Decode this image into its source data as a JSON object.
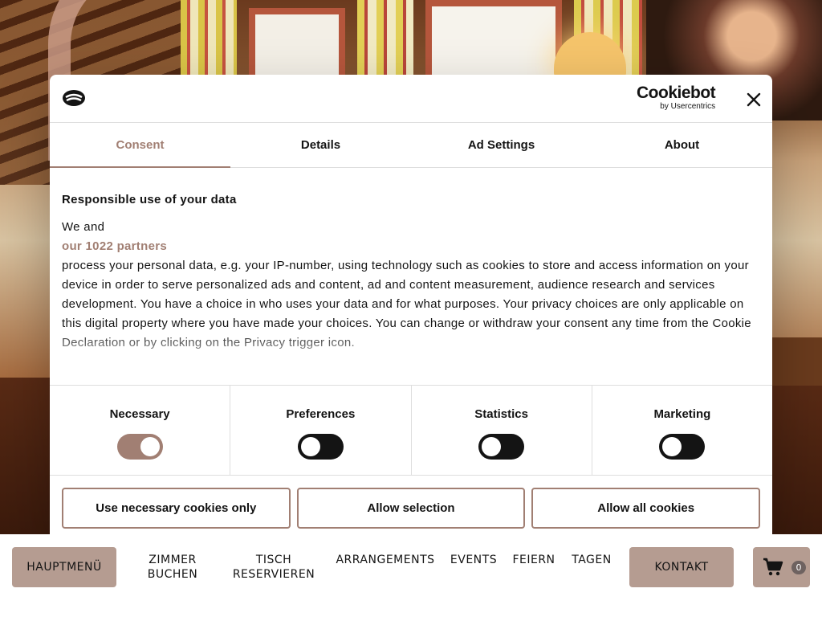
{
  "dialog": {
    "brand": "Cookiebot",
    "brand_sub": "by Usercentrics",
    "tabs": [
      {
        "label": "Consent"
      },
      {
        "label": "Details"
      },
      {
        "label": "Ad Settings"
      },
      {
        "label": "About"
      }
    ],
    "heading": "Responsible use of your data",
    "intro": "We and",
    "partners_link": "our 1022 partners",
    "body": "process your personal data, e.g. your IP-number, using technology such as cookies to store and access information on your device in order to serve personalized ads and content, ad and content measurement, audience research and services development. You have a choice in who uses your data and for what purposes. Your privacy choices are only applicable on this digital property where you have made your choices. You can change or withdraw your consent any time from the Cookie Declaration or by clicking on the Privacy trigger icon.",
    "categories": [
      {
        "label": "Necessary",
        "enabled": true
      },
      {
        "label": "Preferences",
        "enabled": false
      },
      {
        "label": "Statistics",
        "enabled": false
      },
      {
        "label": "Marketing",
        "enabled": false
      }
    ],
    "buttons": {
      "necessary_only": "Use necessary cookies only",
      "allow_selection": "Allow selection",
      "allow_all": "Allow all cookies"
    },
    "accent_color": "#a17f73"
  },
  "nav": {
    "main_menu": "HAUPTMENÜ",
    "rooms_line1": "ZIMMER",
    "rooms_line2": "BUCHEN",
    "table_line1": "TISCH",
    "table_line2": "RESERVIEREN",
    "arrangements": "ARRANGEMENTS",
    "events": "EVENTS",
    "celebrate": "FEIERN",
    "meetings": "TAGEN",
    "contact": "KONTAKT",
    "cart_count": "0",
    "button_color": "#b59c91"
  }
}
